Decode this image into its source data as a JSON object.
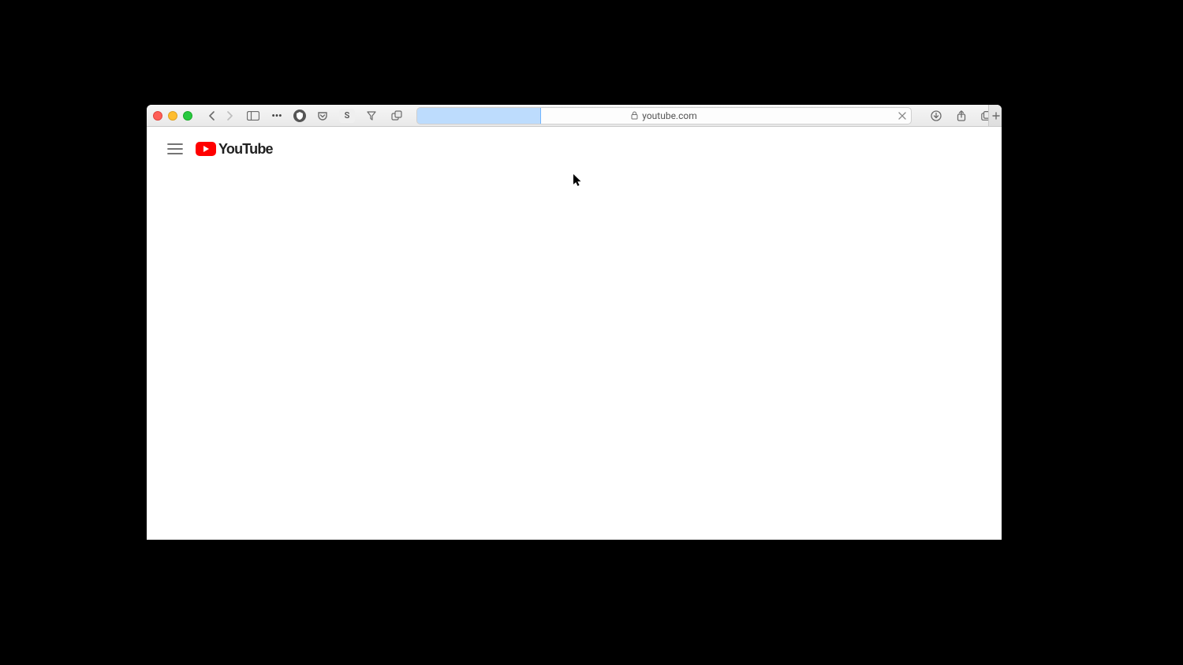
{
  "browser": {
    "address": "youtube.com",
    "loading_progress_percent": 25,
    "extensions": {
      "letter_s": "S"
    }
  },
  "page": {
    "logo_text": "YouTube"
  }
}
